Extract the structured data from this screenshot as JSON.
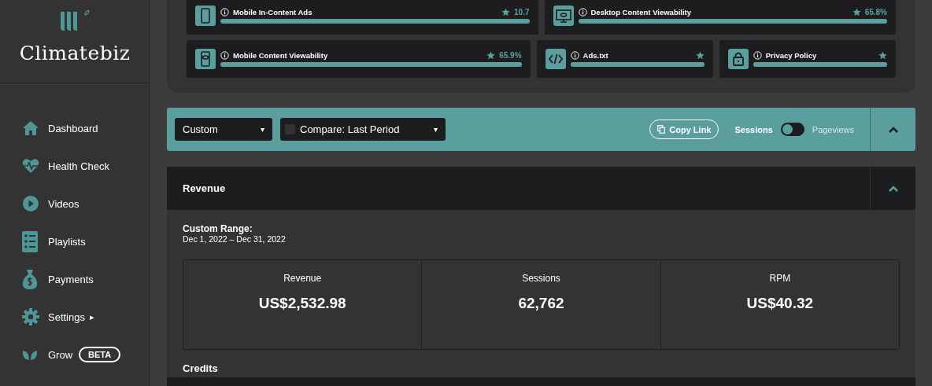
{
  "brand": {
    "name": "Climatebiz"
  },
  "sidebar": {
    "items": [
      {
        "label": "Dashboard"
      },
      {
        "label": "Health Check"
      },
      {
        "label": "Videos"
      },
      {
        "label": "Playlists"
      },
      {
        "label": "Payments"
      },
      {
        "label": "Settings",
        "submenu_caret": "▸"
      },
      {
        "label": "Grow",
        "badge": "BETA"
      }
    ]
  },
  "health_cards": [
    [
      {
        "label": "Mobile In-Content Ads",
        "value": "10.7",
        "level": 1
      },
      {
        "label": "Desktop Content Viewability",
        "value": "65.8%",
        "level": 1
      }
    ],
    [
      {
        "label": "Mobile Content Viewability",
        "value": "65.9%",
        "level": 1
      },
      {
        "label": "Ads.txt",
        "level": 1
      },
      {
        "label": "Privacy Policy",
        "level": 1
      }
    ]
  ],
  "filter_bar": {
    "range": {
      "value": "Custom",
      "caret": "▾"
    },
    "compare": {
      "value": "Compare: Last Period",
      "checked": false,
      "caret": "▾"
    },
    "copy_link": "Copy Link",
    "toggle": {
      "left_label": "Sessions",
      "right_label": "Pageviews",
      "on": false
    },
    "expanded": true
  },
  "revenue": {
    "title": "Revenue",
    "expanded": true,
    "range_label": "Custom Range:",
    "range": "Dec 1, 2022 – Dec 31, 2022",
    "stats": [
      {
        "label": "Revenue",
        "value": "US$2,532.98"
      },
      {
        "label": "Sessions",
        "value": "62,762"
      },
      {
        "label": "RPM",
        "value": "US$40.32"
      }
    ],
    "credits_title": "Credits"
  }
}
